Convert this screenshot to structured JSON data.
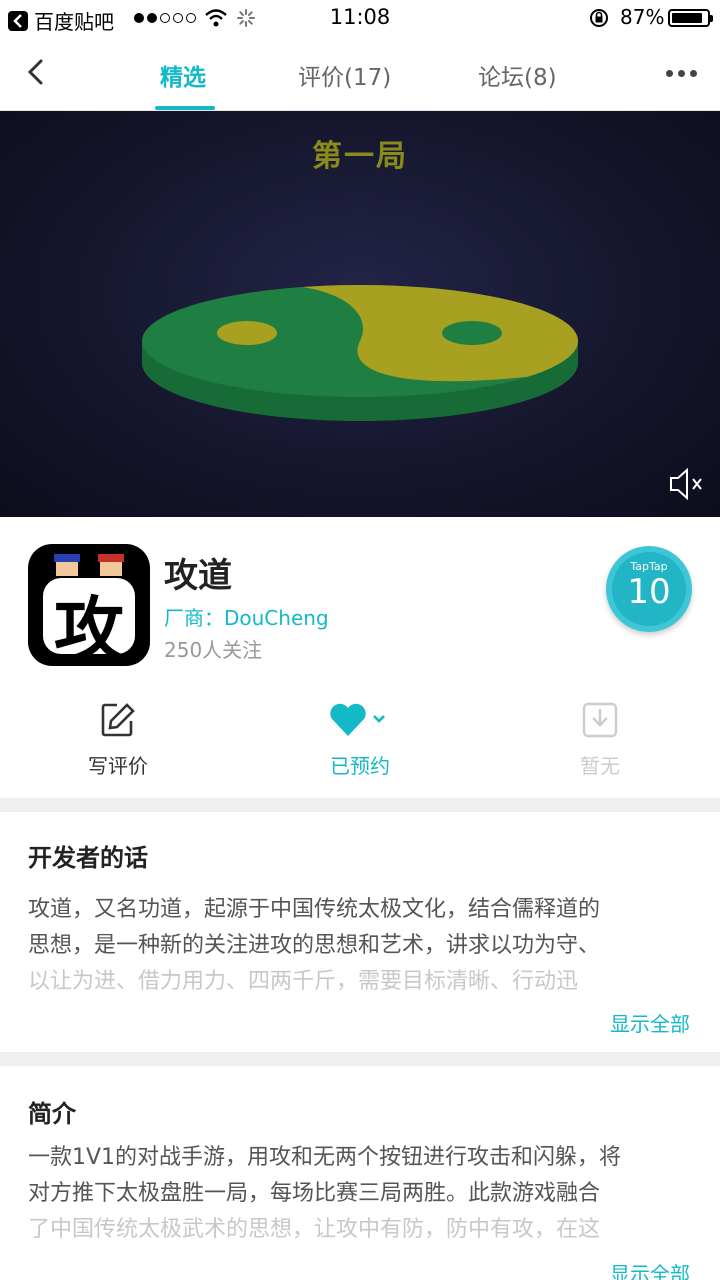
{
  "status_bar": {
    "back_app": "百度贴吧",
    "time": "11:08",
    "battery": "87%",
    "battery_level": 0.87
  },
  "nav": {
    "tabs": [
      {
        "label": "精选",
        "active": true
      },
      {
        "label": "评价(17)",
        "active": false
      },
      {
        "label": "论坛(8)",
        "active": false
      }
    ]
  },
  "video": {
    "title": "第一局",
    "colors": {
      "green": "#1f7a3f",
      "yellow": "#a8a020"
    }
  },
  "app": {
    "icon_char": "攻",
    "name": "攻道",
    "developer": "厂商：DouCheng",
    "followers": "250人关注",
    "score_brand": "TapTap",
    "score": "10"
  },
  "actions": {
    "review": "写评价",
    "reserved": "已预约",
    "download": "暂无"
  },
  "developer_note": {
    "title": "开发者的话",
    "lines": [
      "攻道，又名功道，起源于中国传统太极文化，结合儒释道的",
      "思想，是一种新的关注进攻的思想和艺术，讲求以功为守、",
      "以让为进、借力用力、四两千斤，需要目标清晰、行动迅"
    ],
    "show_all": "显示全部"
  },
  "intro": {
    "title": "简介",
    "lines": [
      "一款1V1的对战手游，用攻和无两个按钮进行攻击和闪躲，将",
      "对方推下太极盘胜一局，每场比赛三局两胜。此款游戏融合",
      "了中国传统太极武术的思想，让攻中有防，防中有攻，在这"
    ],
    "show_all": "显示全部"
  },
  "accent_color": "#14b9c8"
}
